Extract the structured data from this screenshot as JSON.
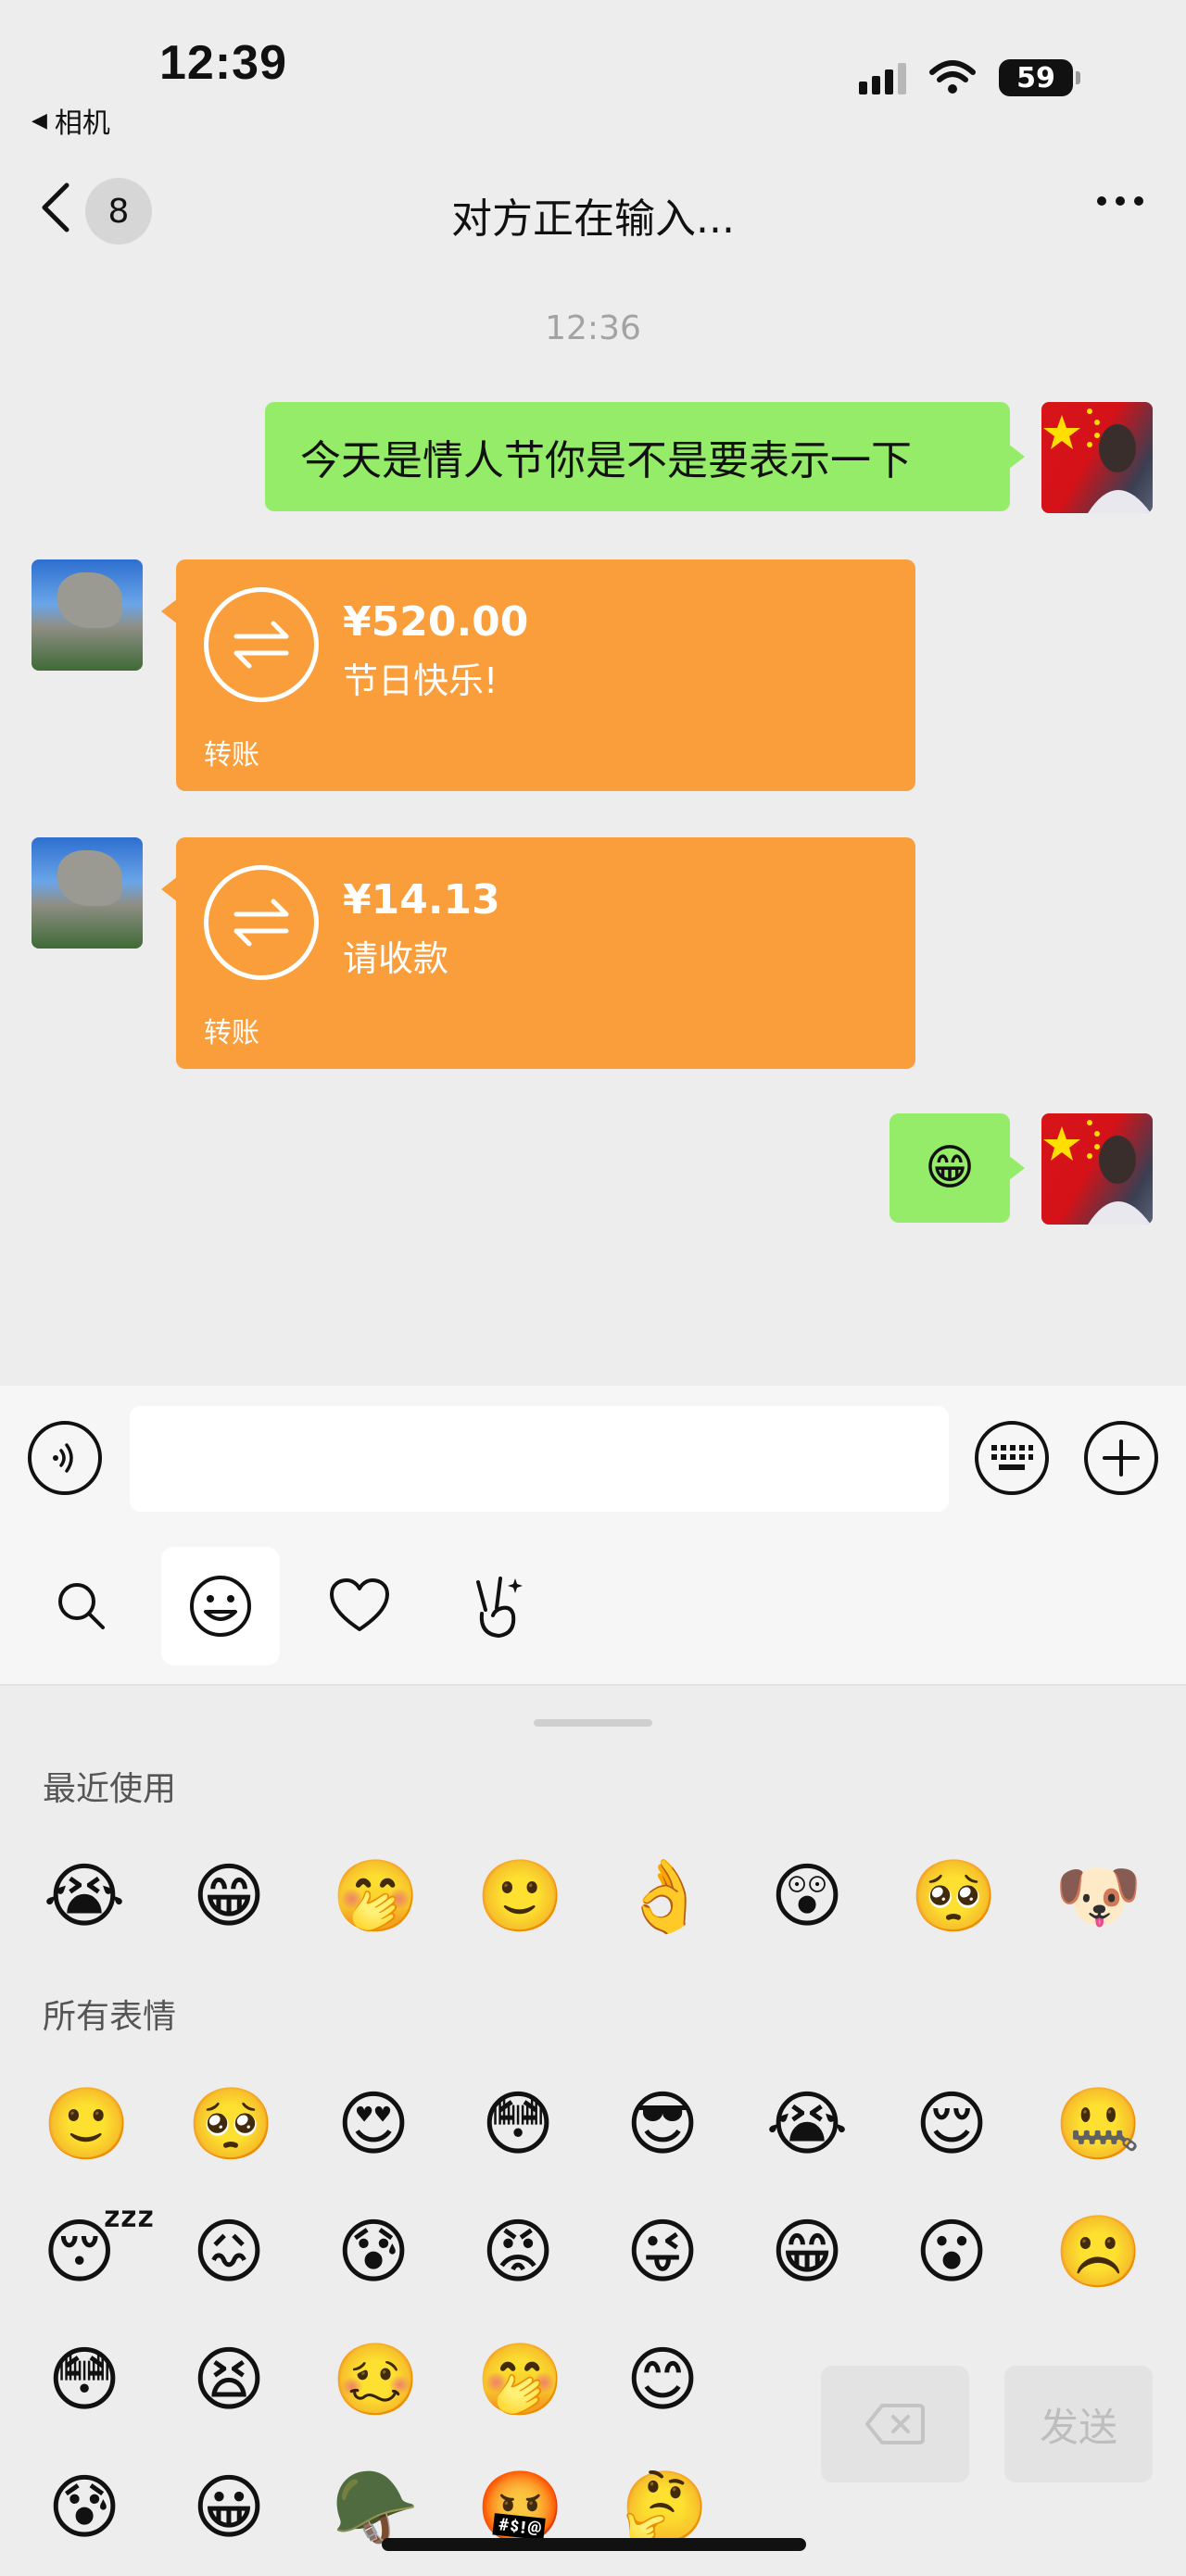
{
  "status_bar": {
    "time": "12:39",
    "back_app": "相机",
    "battery": "59"
  },
  "header": {
    "unread_count": "8",
    "title": "对方正在输入..."
  },
  "chat": {
    "timestamp": "12:36",
    "messages": [
      {
        "from": "me",
        "type": "text",
        "text": "今天是情人节你是不是要表示一下"
      },
      {
        "from": "other",
        "type": "transfer",
        "amount": "¥520.00",
        "note": "节日快乐!",
        "label": "转账"
      },
      {
        "from": "other",
        "type": "transfer",
        "amount": "¥14.13",
        "note": "请收款",
        "label": "转账"
      },
      {
        "from": "me",
        "type": "emoji",
        "text": "😁"
      }
    ]
  },
  "emoji_panel": {
    "recent_title": "最近使用",
    "all_title": "所有表情",
    "recent": [
      "😭",
      "😁",
      "🤭",
      "🙂",
      "👌",
      "😲",
      "🥺",
      "🐶"
    ],
    "all_rows": [
      [
        "🙂",
        "🥺",
        "😍",
        "😳",
        "😎",
        "😭",
        "😌",
        "🤐"
      ],
      [
        "😴",
        "😖",
        "😰",
        "😡",
        "😜",
        "😁",
        "😮",
        "☹️"
      ],
      [
        "😳",
        "😫",
        "🥴",
        "🤭",
        "😊"
      ],
      [
        "😰",
        "😀",
        "🪖",
        "🤬",
        "🤔"
      ]
    ],
    "send_label": "发送"
  }
}
